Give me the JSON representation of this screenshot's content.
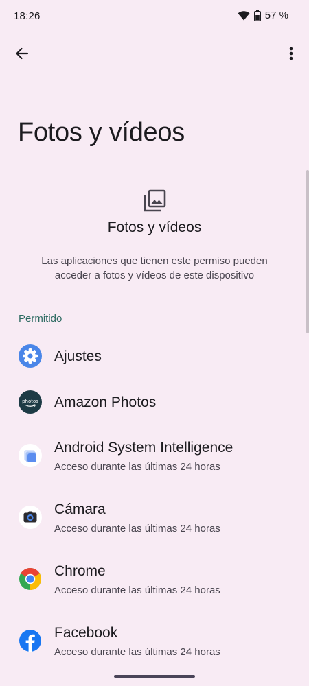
{
  "status_bar": {
    "time": "18:26",
    "battery": "57 %",
    "icons": [
      "wifi-icon",
      "battery-icon"
    ]
  },
  "toolbar": {
    "back_icon": "arrow-back-icon",
    "more_icon": "more-vert-icon"
  },
  "page": {
    "title": "Fotos y vídeos"
  },
  "header": {
    "icon": "photo-library-icon",
    "title": "Fotos y vídeos",
    "description": "Las aplicaciones que tienen este permiso pueden acceder a fotos y vídeos de este dispositivo"
  },
  "section": {
    "label": "Permitido"
  },
  "apps": [
    {
      "name": "Ajustes",
      "subtitle": "",
      "icon": "settings-gear-icon"
    },
    {
      "name": "Amazon Photos",
      "subtitle": "",
      "icon": "amazon-photos-icon"
    },
    {
      "name": "Android System Intelligence",
      "subtitle": "Acceso durante las últimas 24 horas",
      "icon": "android-system-intelligence-icon"
    },
    {
      "name": "Cámara",
      "subtitle": "Acceso durante las últimas 24 horas",
      "icon": "camera-icon"
    },
    {
      "name": "Chrome",
      "subtitle": "Acceso durante las últimas 24 horas",
      "icon": "chrome-icon"
    },
    {
      "name": "Facebook",
      "subtitle": "Acceso durante las últimas 24 horas",
      "icon": "facebook-icon"
    }
  ],
  "colors": {
    "background": "#f8ebf4",
    "accent": "#2e6b62",
    "text_primary": "#1c1b1f",
    "text_secondary": "#49454f"
  }
}
